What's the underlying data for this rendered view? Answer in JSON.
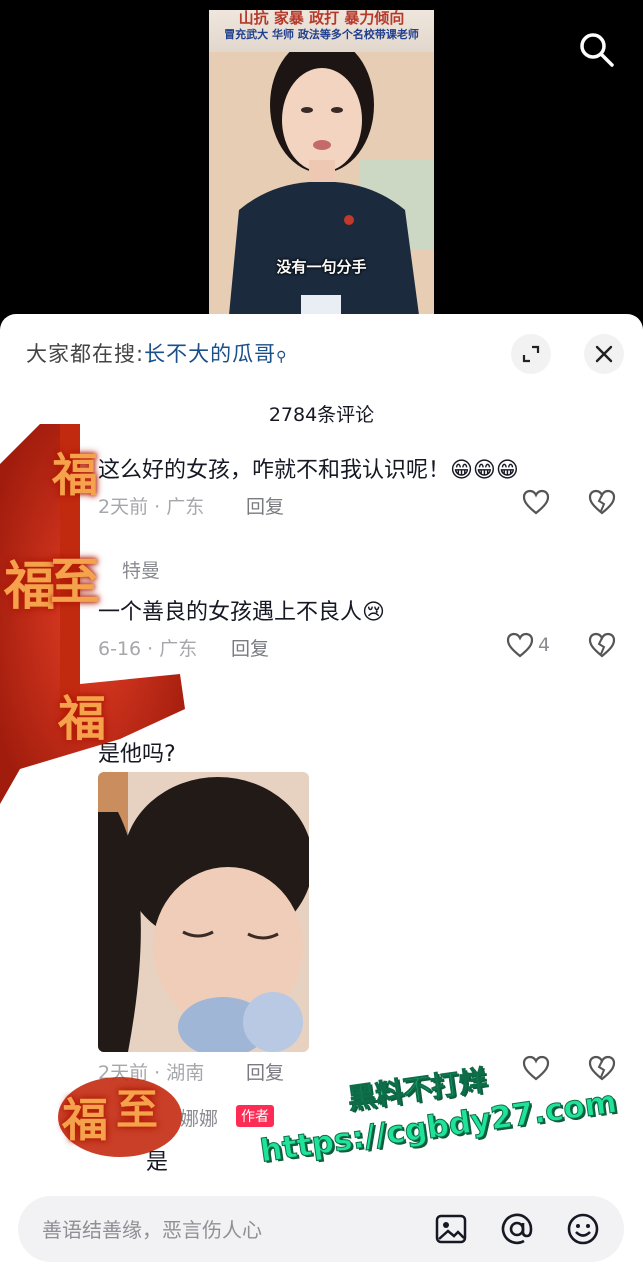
{
  "video": {
    "title_line1": "山抗 家暴 政打 暴力倾向",
    "title_line2": "冒充武大 华师 政法等多个名校带课老师",
    "subtitle": "没有一句分手"
  },
  "search_hint": {
    "prefix": "大家都在搜:",
    "term": "长不大的瓜哥",
    "icon": "search-icon"
  },
  "comment_count": "2784条评论",
  "comments": [
    {
      "text": "这么好的女孩，咋就不和我认识呢！😁😁😁",
      "meta": "2天前 · 广东",
      "reply": "回复",
      "likes": ""
    },
    {
      "user": "特曼",
      "text": "一个善良的女孩遇上不良人😢",
      "meta": "6-16 · 广东",
      "reply": "回复",
      "likes": "4"
    },
    {
      "text": "是他吗?",
      "meta": "2天前 · 湖南",
      "reply": "回复",
      "likes": ""
    },
    {
      "user": "娜娜",
      "badge": "作者",
      "text": "是"
    }
  ],
  "watermark": {
    "line1": "黑料不打烊",
    "line2": "https://cgbdy27.com"
  },
  "decor_chars": [
    "福",
    "福",
    "至",
    "福",
    "福",
    "至"
  ],
  "input": {
    "placeholder": "善语结善缘，恶言伤人心"
  },
  "colors": {
    "accent": "#fe2c55",
    "link": "#1a4f8a",
    "watermark": "#20e39a"
  }
}
